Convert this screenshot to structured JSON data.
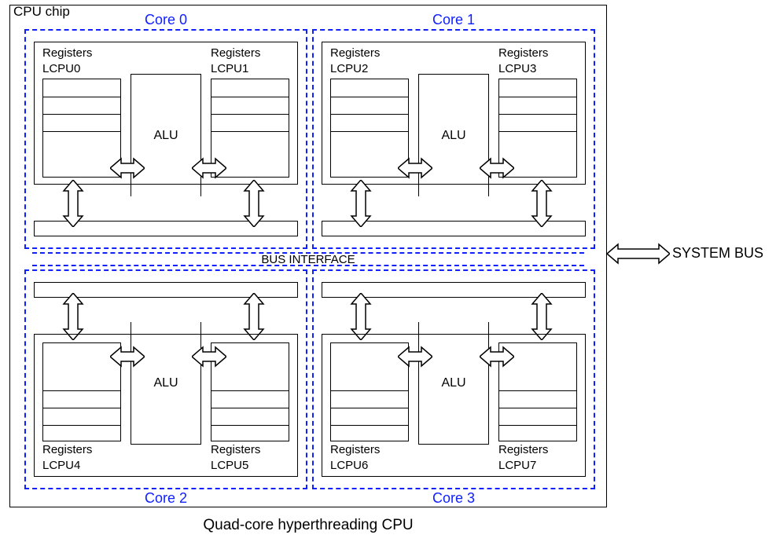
{
  "chip_label": "CPU chip",
  "caption": "Quad-core hyperthreading CPU",
  "bus_interface": "BUS INTERFACE",
  "system_bus": "SYSTEM BUS",
  "cores": [
    {
      "label": "Core 0",
      "alu": "ALU",
      "reg_left_label_a": "Registers",
      "reg_left_label_b": "LCPU0",
      "reg_right_label_a": "Registers",
      "reg_right_label_b": "LCPU1"
    },
    {
      "label": "Core 1",
      "alu": "ALU",
      "reg_left_label_a": "Registers",
      "reg_left_label_b": "LCPU2",
      "reg_right_label_a": "Registers",
      "reg_right_label_b": "LCPU3"
    },
    {
      "label": "Core 2",
      "alu": "ALU",
      "reg_left_label_a": "Registers",
      "reg_left_label_b": "LCPU4",
      "reg_right_label_a": "Registers",
      "reg_right_label_b": "LCPU5"
    },
    {
      "label": "Core 3",
      "alu": "ALU",
      "reg_left_label_a": "Registers",
      "reg_left_label_b": "LCPU6",
      "reg_right_label_a": "Registers",
      "reg_right_label_b": "LCPU7"
    }
  ]
}
